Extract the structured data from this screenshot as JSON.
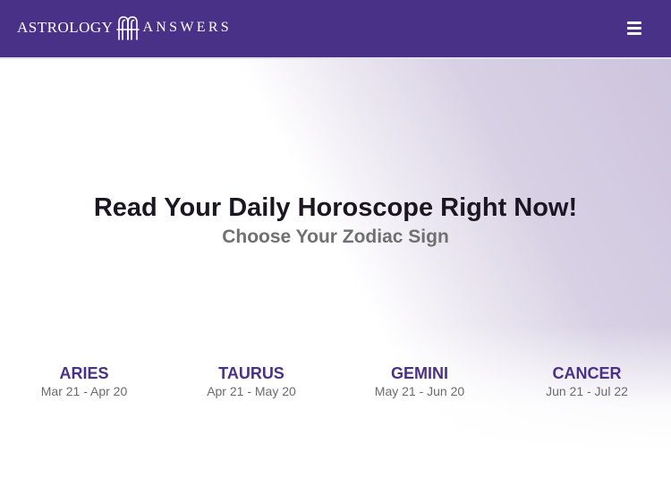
{
  "header": {
    "logo_word_1": "ASTROLOGY",
    "logo_word_2": "ANSWERS",
    "brand_color": "#4a3188",
    "menu_icon": "hamburger-menu-icon"
  },
  "hero": {
    "title": "Read Your Daily Horoscope Right Now!",
    "subtitle": "Choose Your Zodiac Sign"
  },
  "signs": [
    {
      "name": "ARIES",
      "dates": "Mar 21 - Apr 20"
    },
    {
      "name": "TAURUS",
      "dates": "Apr 21 - May 20"
    },
    {
      "name": "GEMINI",
      "dates": "May 21 - Jun 20"
    },
    {
      "name": "CANCER",
      "dates": "Jun 21 - Jul 22"
    }
  ]
}
